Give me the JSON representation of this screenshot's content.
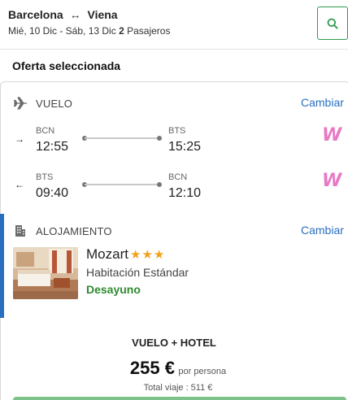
{
  "header": {
    "origin": "Barcelona",
    "swap_symbol": "↔",
    "destination": "Viena",
    "dates": "Mié, 10 Dic - Sáb, 13 Dic",
    "passengers_count": "2",
    "passengers_label": "Pasajeros",
    "search_icon": "search-icon"
  },
  "section_title": "Oferta seleccionada",
  "flight": {
    "label": "VUELO",
    "change_label": "Cambiar",
    "outbound": {
      "direction": "→",
      "from_code": "BCN",
      "from_time": "12:55",
      "to_code": "BTS",
      "to_time": "15:25",
      "airline_logo_text": "W"
    },
    "inbound": {
      "direction": "←",
      "from_code": "BTS",
      "from_time": "09:40",
      "to_code": "BCN",
      "to_time": "12:10",
      "airline_logo_text": "W"
    }
  },
  "hotel": {
    "label": "ALOJAMIENTO",
    "change_label": "Cambiar",
    "name": "Mozart",
    "stars": "★★★",
    "room_type": "Habitación Estándar",
    "board": "Desayuno"
  },
  "summary": {
    "combo_label": "VUELO + HOTEL",
    "price": "255 €",
    "price_unit": "por persona",
    "total": "Total viaje : 511 €"
  },
  "colors": {
    "accent_green": "#2e9a4e",
    "link_blue": "#2a6fbf",
    "airline_pink": "#e879c6",
    "star_gold": "#f4a11a"
  }
}
